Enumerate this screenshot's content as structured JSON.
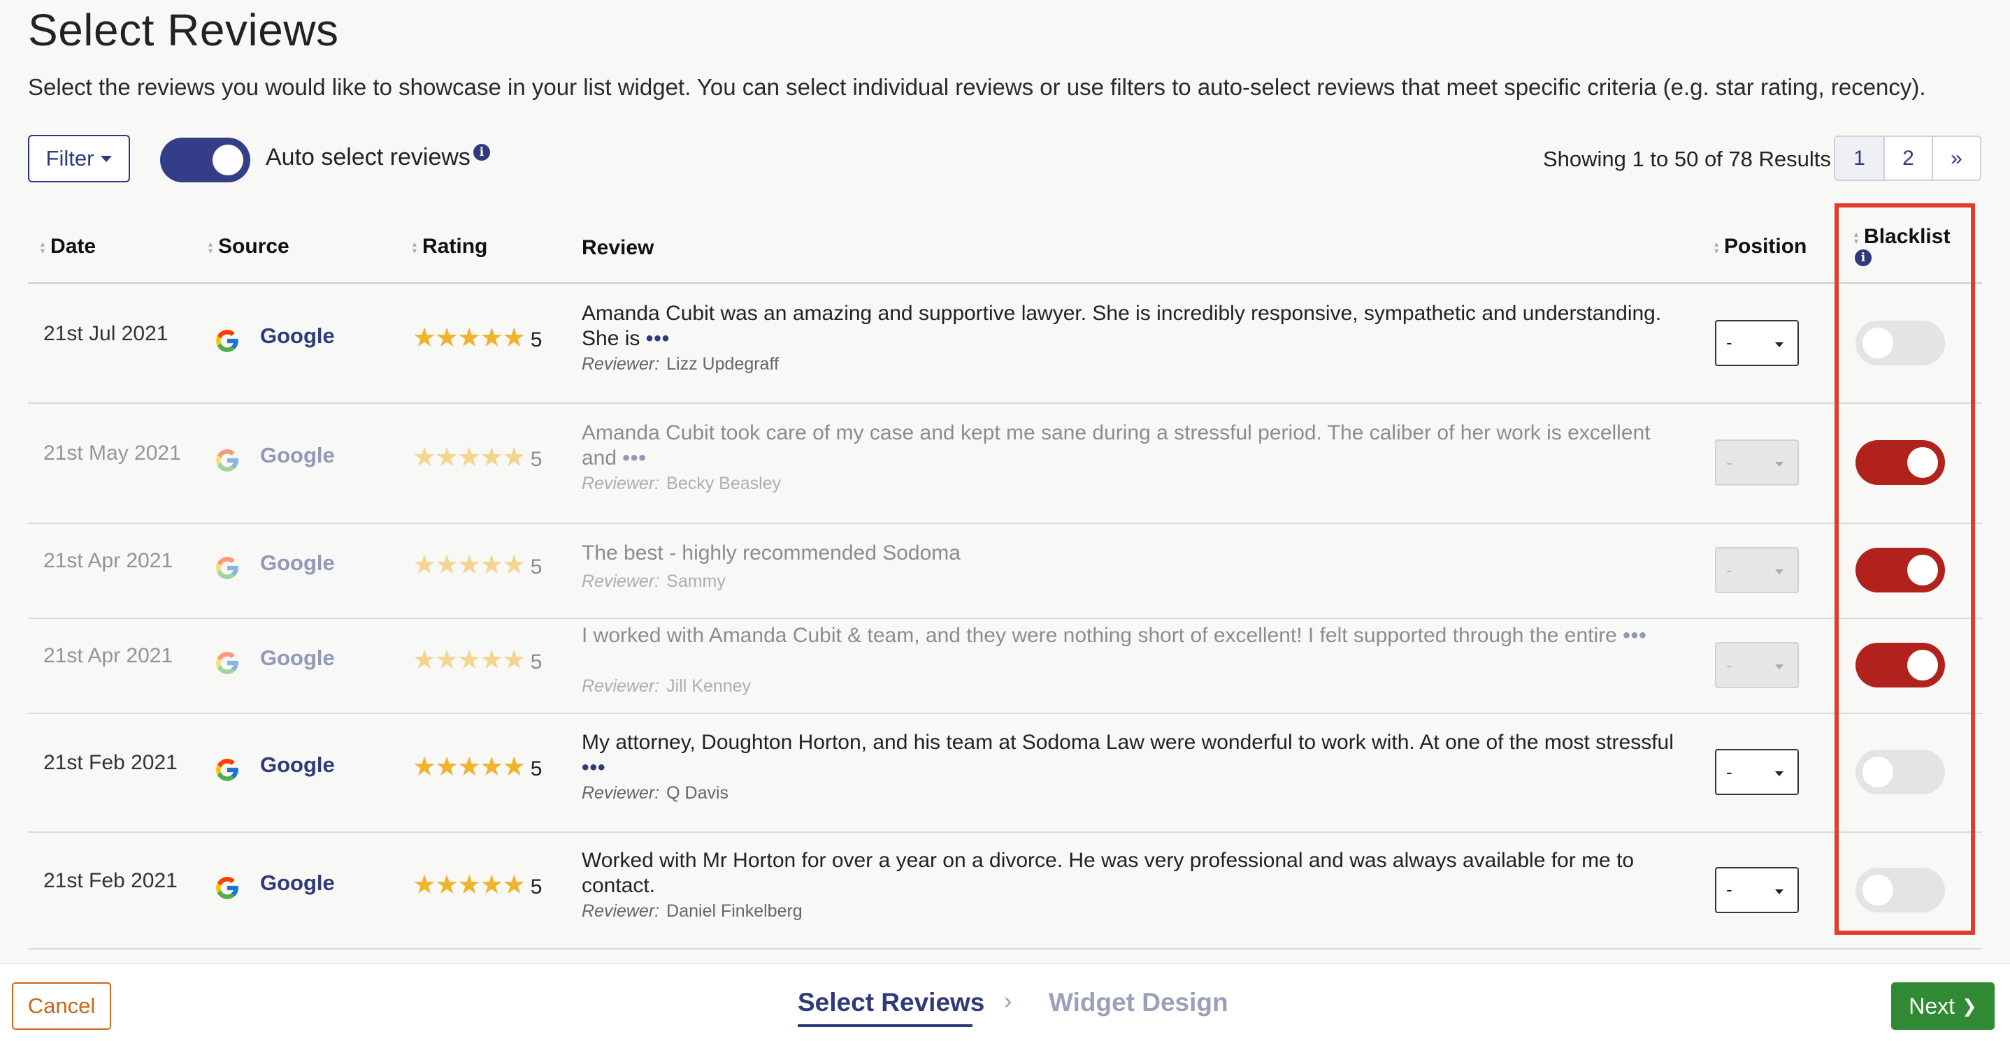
{
  "page": {
    "title": "Select Reviews",
    "subtitle": "Select the reviews you would like to showcase in your list widget. You can select individual reviews or use filters to auto-select reviews that meet specific criteria (e.g. star rating, recency)."
  },
  "toolbar": {
    "filter_label": "Filter",
    "auto_select_label": "Auto select reviews",
    "auto_select_on": true,
    "showing_text": "Showing 1 to 50 of 78 Results",
    "pages": [
      "1",
      "2",
      "»"
    ]
  },
  "table": {
    "headers": {
      "date": "Date",
      "source": "Source",
      "rating": "Rating",
      "review": "Review",
      "position": "Position",
      "blacklist": "Blacklist"
    },
    "reviewer_prefix": "Reviewer:",
    "rows": [
      {
        "date": "21st Jul 2021",
        "source": "Google",
        "stars": "★★★★★",
        "rating": "5",
        "review": "Amanda Cubit was an amazing and supportive lawyer. She is incredibly responsive, sympathetic and understanding. She is",
        "more": "•••",
        "reviewer": "Lizz Updegraff",
        "position": "-",
        "blacklisted": false
      },
      {
        "date": "21st May 2021",
        "source": "Google",
        "stars": "★★★★★",
        "rating": "5",
        "review": "Amanda Cubit took care of my case and kept me sane during a stressful period. The caliber of her work is excellent and",
        "more": "•••",
        "reviewer": "Becky Beasley",
        "position": "-",
        "blacklisted": true
      },
      {
        "date": "21st Apr 2021",
        "source": "Google",
        "stars": "★★★★★",
        "rating": "5",
        "review": "The best - highly recommended Sodoma",
        "more": "",
        "reviewer": "Sammy",
        "position": "-",
        "blacklisted": true
      },
      {
        "date": "21st Apr 2021",
        "source": "Google",
        "stars": "★★★★★",
        "rating": "5",
        "review": "I worked with Amanda Cubit & team, and they were nothing short of excellent! I felt supported through the entire",
        "more": "•••",
        "reviewer": "Jill Kenney",
        "position": "-",
        "blacklisted": true
      },
      {
        "date": "21st Feb 2021",
        "source": "Google",
        "stars": "★★★★★",
        "rating": "5",
        "review": "My attorney, Doughton Horton, and his team at Sodoma Law were wonderful to work with. At one of the most stressful",
        "more": "•••",
        "reviewer": "Q Davis",
        "position": "-",
        "blacklisted": false
      },
      {
        "date": "21st Feb 2021",
        "source": "Google",
        "stars": "★★★★★",
        "rating": "5",
        "review": "Worked with Mr Horton for over a year on a divorce. He was very professional and was always available for me to contact.",
        "more": "",
        "reviewer": "Daniel Finkelberg",
        "position": "-",
        "blacklisted": false
      }
    ]
  },
  "footer": {
    "cancel_label": "Cancel",
    "steps": [
      "Select Reviews",
      "Widget Design"
    ],
    "arrow": "›",
    "next_label": "Next",
    "next_arrow": "❯"
  },
  "colors": {
    "brand_navy": "#2e3a7a",
    "blacklist_on": "#b1221c",
    "highlight_box": "#e33b2e",
    "next_green": "#2f8a33",
    "cancel_orange": "#c9661c",
    "star_gold": "#f1b32c"
  },
  "icons": {
    "info": "info-icon",
    "google": "google-icon",
    "caret": "caret-down-icon",
    "sort": "sort-icon"
  }
}
